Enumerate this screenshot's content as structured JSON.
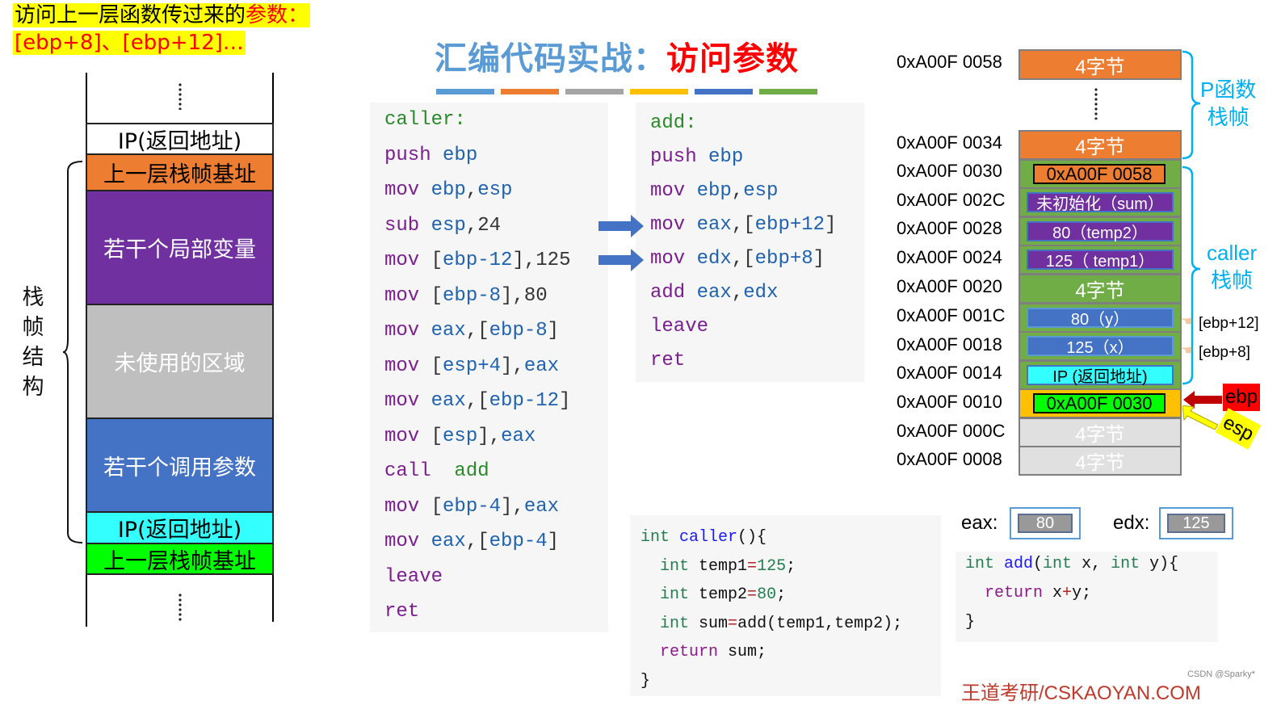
{
  "note": {
    "line1_black": "访问上一层函数传过来的",
    "line1_red": "参数：",
    "line2_red": "[ebp+8]、[ebp+12]…"
  },
  "title": {
    "prefix": "汇编代码实战：",
    "highlight": "访问参数"
  },
  "title_bar_colors": [
    "#5b9bd5",
    "#ed7d31",
    "#a5a5a5",
    "#ffc000",
    "#4472c4",
    "#70ad47"
  ],
  "left_stack": {
    "label": [
      "栈",
      "帧",
      "结",
      "构"
    ],
    "cells": [
      {
        "text": "IP(返回地址)",
        "bg": "#ffffff",
        "fg": "#000000"
      },
      {
        "text": "上一层栈帧基址",
        "bg": "#ed7d31",
        "fg": "#000000"
      },
      {
        "text": "若干个局部变量",
        "bg": "#7030a0",
        "fg": "#ffffff"
      },
      {
        "text": "未使用的区域",
        "bg": "#bfbfbf",
        "fg": "#ffffff"
      },
      {
        "text": "若干个调用参数",
        "bg": "#4472c4",
        "fg": "#ffffff"
      },
      {
        "text": "IP(返回地址)",
        "bg": "#33ffff",
        "fg": "#000000"
      },
      {
        "text": "上一层栈帧基址",
        "bg": "#00ff00",
        "fg": "#000000"
      }
    ]
  },
  "caller_asm": {
    "label": "caller:",
    "lines": [
      {
        "op": "push",
        "args": [
          [
            "reg",
            "ebp"
          ]
        ]
      },
      {
        "op": "mov",
        "args": [
          [
            "reg",
            "ebp"
          ],
          [
            "pun",
            ","
          ],
          [
            "reg",
            "esp"
          ]
        ]
      },
      {
        "op": "sub",
        "args": [
          [
            "reg",
            "esp"
          ],
          [
            "pun",
            ","
          ],
          [
            "num",
            "24"
          ]
        ]
      },
      {
        "op": "mov",
        "args": [
          [
            "pun",
            "["
          ],
          [
            "reg",
            "ebp-12"
          ],
          [
            "pun",
            "],"
          ],
          [
            "num",
            "125"
          ]
        ]
      },
      {
        "op": "mov",
        "args": [
          [
            "pun",
            "["
          ],
          [
            "reg",
            "ebp-8"
          ],
          [
            "pun",
            "],"
          ],
          [
            "num",
            "80"
          ]
        ]
      },
      {
        "op": "mov",
        "args": [
          [
            "reg",
            "eax"
          ],
          [
            "pun",
            ",["
          ],
          [
            "reg",
            "ebp-8"
          ],
          [
            "pun",
            "]"
          ]
        ]
      },
      {
        "op": "mov",
        "args": [
          [
            "pun",
            "["
          ],
          [
            "reg",
            "esp+4"
          ],
          [
            "pun",
            "],"
          ],
          [
            "reg",
            "eax"
          ]
        ]
      },
      {
        "op": "mov",
        "args": [
          [
            "reg",
            "eax"
          ],
          [
            "pun",
            ",["
          ],
          [
            "reg",
            "ebp-12"
          ],
          [
            "pun",
            "]"
          ]
        ]
      },
      {
        "op": "mov",
        "args": [
          [
            "pun",
            "["
          ],
          [
            "reg",
            "esp"
          ],
          [
            "pun",
            "],"
          ],
          [
            "reg",
            "eax"
          ]
        ]
      },
      {
        "op": "call",
        "args": [
          [
            "lbl",
            " add"
          ]
        ]
      },
      {
        "op": "mov",
        "args": [
          [
            "pun",
            "["
          ],
          [
            "reg",
            "ebp-4"
          ],
          [
            "pun",
            "],"
          ],
          [
            "reg",
            "eax"
          ]
        ]
      },
      {
        "op": "mov",
        "args": [
          [
            "reg",
            "eax"
          ],
          [
            "pun",
            ",["
          ],
          [
            "reg",
            "ebp-4"
          ],
          [
            "pun",
            "]"
          ]
        ]
      },
      {
        "op": "leave",
        "args": []
      },
      {
        "op": "ret",
        "args": []
      }
    ]
  },
  "add_asm": {
    "label": "add:",
    "lines": [
      {
        "op": "push",
        "args": [
          [
            "reg",
            "ebp"
          ]
        ]
      },
      {
        "op": "mov",
        "args": [
          [
            "reg",
            "ebp"
          ],
          [
            "pun",
            ","
          ],
          [
            "reg",
            "esp"
          ]
        ]
      },
      {
        "op": "mov",
        "args": [
          [
            "reg",
            "eax"
          ],
          [
            "pun",
            ",["
          ],
          [
            "reg",
            "ebp+12"
          ],
          [
            "pun",
            "]"
          ]
        ]
      },
      {
        "op": "mov",
        "args": [
          [
            "reg",
            "edx"
          ],
          [
            "pun",
            ",["
          ],
          [
            "reg",
            "ebp+8"
          ],
          [
            "pun",
            "]"
          ]
        ]
      },
      {
        "op": "add",
        "args": [
          [
            "reg",
            "eax"
          ],
          [
            "pun",
            ","
          ],
          [
            "reg",
            "edx"
          ]
        ]
      },
      {
        "op": "leave",
        "args": []
      },
      {
        "op": "ret",
        "args": []
      }
    ]
  },
  "caller_c": [
    [
      [
        "c-type",
        "int "
      ],
      [
        "c-fn",
        "caller"
      ],
      [
        "",
        "(){"
      ]
    ],
    [
      [
        "",
        "  "
      ],
      [
        "c-type",
        "int "
      ],
      [
        "",
        "temp1"
      ],
      [
        "c-op",
        "="
      ],
      [
        "c-num",
        "125"
      ],
      [
        "",
        ";"
      ]
    ],
    [
      [
        "",
        "  "
      ],
      [
        "c-type",
        "int "
      ],
      [
        "",
        "temp2"
      ],
      [
        "c-op",
        "="
      ],
      [
        "c-num",
        "80"
      ],
      [
        "",
        ";"
      ]
    ],
    [
      [
        "",
        "  "
      ],
      [
        "c-type",
        "int "
      ],
      [
        "",
        "sum"
      ],
      [
        "c-op",
        "="
      ],
      [
        "",
        "add(temp1,temp2);"
      ]
    ],
    [
      [
        "",
        "  "
      ],
      [
        "c-kw",
        "return "
      ],
      [
        "",
        "sum;"
      ]
    ],
    [
      [
        "",
        "}"
      ]
    ]
  ],
  "add_c": [
    [
      [
        "c-type",
        "int "
      ],
      [
        "c-fn",
        "add"
      ],
      [
        "",
        "("
      ],
      [
        "c-type",
        "int "
      ],
      [
        "",
        "x, "
      ],
      [
        "c-type",
        "int "
      ],
      [
        "",
        "y){"
      ]
    ],
    [
      [
        "",
        "  "
      ],
      [
        "c-kw",
        "return "
      ],
      [
        "",
        "x"
      ],
      [
        "c-op",
        "+"
      ],
      [
        "",
        "y;"
      ]
    ],
    [
      [
        "",
        "}"
      ]
    ]
  ],
  "registers": {
    "eax": {
      "label": "eax:",
      "value": "80"
    },
    "edx": {
      "label": "edx:",
      "value": "125"
    }
  },
  "memory": {
    "addresses": [
      "0xA00F 0058",
      "0xA00F 0034",
      "0xA00F 0030",
      "0xA00F 002C",
      "0xA00F 0028",
      "0xA00F 0024",
      "0xA00F 0020",
      "0xA00F 001C",
      "0xA00F 0018",
      "0xA00F 0014",
      "0xA00F 0010",
      "0xA00F 000C",
      "0xA00F 0008"
    ],
    "cells": [
      {
        "text": "4字节",
        "bg": "#ed7d31"
      },
      {
        "text": "4字节",
        "bg": "#ed7d31"
      },
      {
        "text": "",
        "bg": "#70ad47",
        "inner": {
          "text": "0xA00F 0058",
          "bg": "#ed7d31",
          "fg": "#000000",
          "border": "#000000"
        }
      },
      {
        "text": "",
        "bg": "#70ad47",
        "inner": {
          "text": "未初始化（sum）",
          "bg": "#7030a0",
          "fg": "#ffffff",
          "border": "#4472c4"
        }
      },
      {
        "text": "",
        "bg": "#70ad47",
        "inner": {
          "text": "80（temp2）",
          "bg": "#7030a0",
          "fg": "#ffffff",
          "border": "#4472c4"
        }
      },
      {
        "text": "",
        "bg": "#70ad47",
        "inner": {
          "text": "125（ temp1）",
          "bg": "#7030a0",
          "fg": "#ffffff",
          "border": "#4472c4"
        }
      },
      {
        "text": "4字节",
        "bg": "#70ad47"
      },
      {
        "text": "",
        "bg": "#70ad47",
        "inner": {
          "text": "80（y）",
          "bg": "#4472c4",
          "fg": "#ffffff",
          "border": "#5b9bd5"
        }
      },
      {
        "text": "",
        "bg": "#70ad47",
        "inner": {
          "text": "125（x）",
          "bg": "#4472c4",
          "fg": "#ffffff",
          "border": "#5b9bd5"
        }
      },
      {
        "text": "",
        "bg": "#70ad47",
        "inner": {
          "text": "IP (返回地址)",
          "bg": "#33ffff",
          "fg": "#000000",
          "border": "#4472c4"
        }
      },
      {
        "text": "",
        "bg": "#ffc000",
        "inner": {
          "text": "0xA00F 0030",
          "bg": "#00ff00",
          "fg": "#000000",
          "border": "#000000"
        }
      },
      {
        "text": "4字节",
        "bg": "#e0e0e0"
      },
      {
        "text": "4字节",
        "bg": "#e0e0e0"
      }
    ],
    "p_frame_label": [
      "P函数",
      "栈帧"
    ],
    "caller_frame_label": [
      "caller",
      "栈帧"
    ],
    "ref_plus12": "[ebp+12]",
    "ref_plus8": "[ebp+8]",
    "ebp_tag": "ebp",
    "esp_tag": "esp"
  },
  "footer": {
    "watermark": "王道考研/CSKAOYAN.COM",
    "credit": "CSDN @Sparky*"
  }
}
